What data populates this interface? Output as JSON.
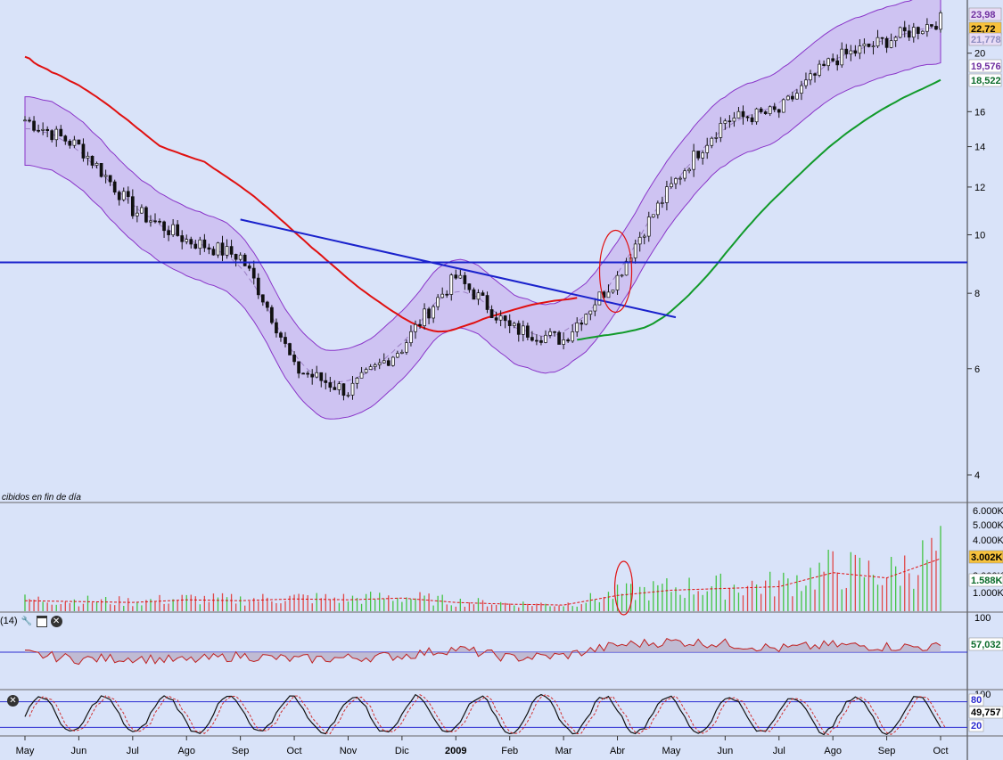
{
  "price_panel": {
    "note": "cibidos en fin de día",
    "y_ticks": [
      "4",
      "6",
      "8",
      "10",
      "12",
      "14",
      "16",
      "20"
    ],
    "tags": [
      {
        "label": "23,98",
        "color": "#7030a0",
        "bg": "#e8dcf6"
      },
      {
        "label": "22,72",
        "color": "#000000",
        "bg": "#f7c23c"
      },
      {
        "label": "21,778",
        "color": "#8c8cc0",
        "bg": "#e8dcf6"
      },
      {
        "label": "19,576",
        "color": "#7030a0",
        "bg": "#ffffff"
      },
      {
        "label": "18,522",
        "color": "#0b6b2a",
        "bg": "#ffffff"
      }
    ]
  },
  "volume_panel": {
    "y_ticks": [
      "6.000K",
      "5.000K",
      "4.000K",
      "3.000K",
      "1.000K"
    ],
    "tags": [
      {
        "label": "3.002K",
        "color": "#000000",
        "bg": "#f7c23c"
      },
      {
        "label": "1.588K",
        "color": "#0b6b2a",
        "bg": "#ffffff"
      }
    ]
  },
  "rsi_panel": {
    "toolbar_label": "(14)",
    "y_ticks": [
      "100"
    ],
    "tags": [
      {
        "label": "57,032",
        "color": "#0b6b2a",
        "bg": "#ffffff"
      }
    ]
  },
  "stoch_panel": {
    "y_ticks": [
      "100"
    ],
    "tags": [
      {
        "label": "80",
        "color": "#2b2bd0",
        "bg": "#ffffff"
      },
      {
        "label": "49,757",
        "color": "#000000",
        "bg": "#ffffff"
      },
      {
        "label": "20",
        "color": "#2b2bd0",
        "bg": "#ffffff"
      }
    ]
  },
  "x_axis": [
    "May",
    "Jun",
    "Jul",
    "Ago",
    "Sep",
    "Oct",
    "Nov",
    "Dic",
    "2009",
    "Feb",
    "Mar",
    "Abr",
    "May",
    "Jun",
    "Jul",
    "Ago",
    "Sep",
    "Oct"
  ],
  "chart_data": [
    {
      "type": "line",
      "description_series": "price (candlestick) with Bollinger bands, 200-day MA (red), MA (green)",
      "categories": [
        "May",
        "Jun",
        "Jul",
        "Ago",
        "Sep",
        "Oct",
        "Nov",
        "Dic",
        "2009",
        "Feb",
        "Mar",
        "Abr",
        "May",
        "Jun",
        "Jul",
        "Ago",
        "Sep",
        "Oct"
      ],
      "series": [
        {
          "name": "",
          "values": [
            15.5,
            14.0,
            11.0,
            9.8,
            9.2,
            6.0,
            5.5,
            6.5,
            8.5,
            7.0,
            6.7,
            8.5,
            12.0,
            15.5,
            16.0,
            19.5,
            21.0,
            22.7
          ]
        }
      ],
      "yscale": "log",
      "ylim": [
        3.6,
        24.5
      ],
      "colors": {
        "band": "#c9b8ef",
        "band_line": "#8a35c9",
        "ma_red": "#e01010",
        "ma_green": "#119a2a",
        "trend": "#1a22cc"
      }
    },
    {
      "type": "bar",
      "series": [
        {
          "name": "",
          "values": [
            600,
            550,
            500,
            650,
            600,
            700,
            650,
            750,
            500,
            400,
            350,
            900,
            1200,
            1300,
            1400,
            2200,
            1900,
            3002
          ]
        }
      ],
      "categories": [
        "May",
        "Jun",
        "Jul",
        "Ago",
        "Sep",
        "Oct",
        "Nov",
        "Dic",
        "2009",
        "Feb",
        "Mar",
        "Abr",
        "May",
        "Jun",
        "Jul",
        "Ago",
        "Sep",
        "Oct"
      ],
      "ylim": [
        0,
        6000
      ]
    },
    {
      "type": "area",
      "series": [
        {
          "name": "",
          "values": [
            48,
            40,
            42,
            38,
            45,
            40,
            42,
            45,
            55,
            42,
            45,
            60,
            65,
            62,
            55,
            60,
            58,
            57.032
          ]
        }
      ],
      "categories": [
        "May",
        "Jun",
        "Jul",
        "Ago",
        "Sep",
        "Oct",
        "Nov",
        "Dic",
        "2009",
        "Feb",
        "Mar",
        "Abr",
        "May",
        "Jun",
        "Jul",
        "Ago",
        "Sep",
        "Oct"
      ],
      "ylim": [
        0,
        100
      ]
    },
    {
      "type": "line",
      "series": [
        {
          "name": "",
          "values": [
            60,
            20,
            70,
            30,
            80,
            25,
            75,
            40,
            85,
            30,
            80,
            60,
            75,
            40,
            80,
            35,
            85,
            49.757
          ]
        }
      ],
      "categories": [
        "May",
        "Jun",
        "Jul",
        "Ago",
        "Sep",
        "Oct",
        "Nov",
        "Dic",
        "2009",
        "Feb",
        "Mar",
        "Abr",
        "May",
        "Jun",
        "Jul",
        "Ago",
        "Sep",
        "Oct"
      ],
      "ylim": [
        0,
        100
      ]
    }
  ]
}
